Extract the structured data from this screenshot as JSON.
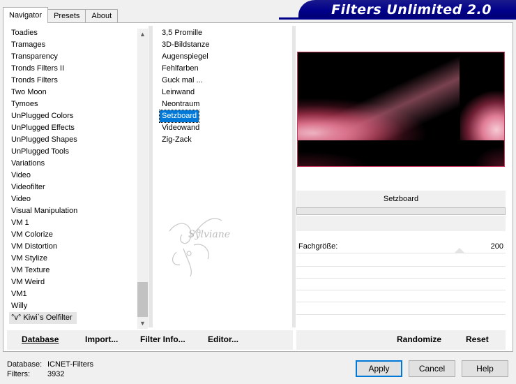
{
  "tabs": [
    "Navigator",
    "Presets",
    "About"
  ],
  "banner_title": "Filters Unlimited 2.0",
  "categories": [
    "Toadies",
    "Tramages",
    "Transparency",
    "Tronds Filters II",
    "Tronds Filters",
    "Two Moon",
    "Tymoes",
    "UnPlugged Colors",
    "UnPlugged Effects",
    "UnPlugged Shapes",
    "UnPlugged Tools",
    "Variations",
    "Video",
    "Videofilter",
    "Video",
    "Visual Manipulation",
    "VM 1",
    "VM Colorize",
    "VM Distortion",
    "VM Stylize",
    "VM Texture",
    "VM Weird",
    "VM1",
    "Willy",
    "°v° Kiwi`s Oelfilter"
  ],
  "filters": [
    "3,5 Promille",
    "3D-Bildstanze",
    "Augenspiegel",
    "Fehlfarben",
    "Guck mal ...",
    "Leinwand",
    "Neontraum",
    "Setzboard",
    "Videowand",
    "Zig-Zack"
  ],
  "selected_filter_index": 7,
  "highlighted_category_index": 24,
  "watermark_text": "Sylviane",
  "filter_name": "Setzboard",
  "parameter": {
    "label": "Fachgröße:",
    "value": "200"
  },
  "bottom_left": {
    "database": "Database",
    "import": "Import...",
    "filter_info": "Filter Info...",
    "editor": "Editor..."
  },
  "bottom_right": {
    "randomize": "Randomize",
    "reset": "Reset"
  },
  "status": {
    "database_label": "Database:",
    "database_value": "ICNET-Filters",
    "filters_label": "Filters:",
    "filters_value": "3932"
  },
  "buttons": {
    "apply": "Apply",
    "cancel": "Cancel",
    "help": "Help"
  },
  "icons": {
    "scroll_up": "chevron-up-icon",
    "scroll_down": "chevron-down-icon"
  },
  "colors": {
    "banner": "#00008b",
    "selection": "#0078d7",
    "preview_border": "#c83a5e"
  }
}
